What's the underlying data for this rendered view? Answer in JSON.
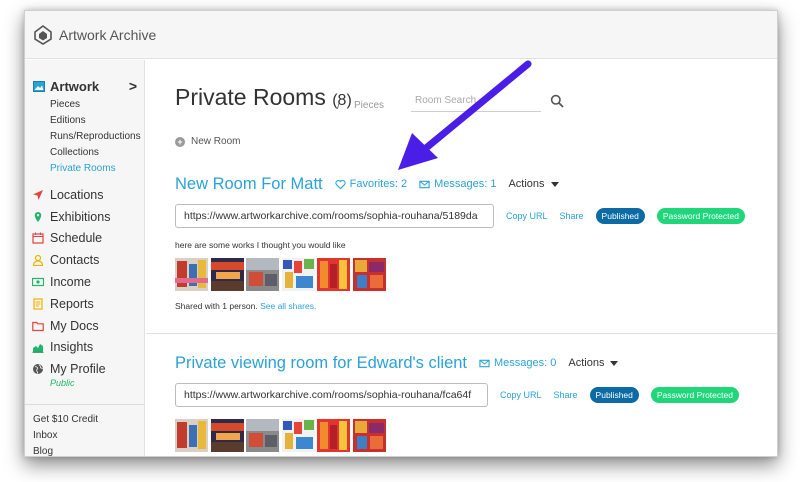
{
  "app": {
    "name": "Artwork Archive"
  },
  "sidebar": {
    "section": {
      "label": "Artwork",
      "expand": ">"
    },
    "subitems": [
      "Pieces",
      "Editions",
      "Runs/Reproductions",
      "Collections",
      "Private Rooms"
    ],
    "active_subitem": "Private Rooms",
    "nav": [
      {
        "label": "Locations",
        "icon": "location-arrow-icon",
        "color": "#e0443a"
      },
      {
        "label": "Exhibitions",
        "icon": "map-pin-icon",
        "color": "#1fb56b"
      },
      {
        "label": "Schedule",
        "icon": "calendar-icon",
        "color": "#e0443a"
      },
      {
        "label": "Contacts",
        "icon": "user-icon",
        "color": "#f0b400"
      },
      {
        "label": "Income",
        "icon": "money-icon",
        "color": "#1fb56b"
      },
      {
        "label": "Reports",
        "icon": "report-icon",
        "color": "#f0b400"
      },
      {
        "label": "My Docs",
        "icon": "folder-icon",
        "color": "#e0443a"
      },
      {
        "label": "Insights",
        "icon": "chart-icon",
        "color": "#1fb56b"
      },
      {
        "label": "My Profile",
        "icon": "globe-icon",
        "color": "#555555"
      }
    ],
    "profile_sub": "Public",
    "bottom_links": [
      "Get $10 Credit",
      "Inbox",
      "Blog"
    ]
  },
  "main": {
    "title": "Private Rooms",
    "count": "(8)",
    "breadcrumb_sep": "/",
    "breadcrumb": "Pieces",
    "search_placeholder": "Room Search",
    "new_room_label": "New Room"
  },
  "rooms": [
    {
      "title": "New Room For Matt",
      "favorites": "Favorites: 2",
      "messages": "Messages: 1",
      "actions": "Actions",
      "url": "https://www.artworkarchive.com/rooms/sophia-rouhana/5189da",
      "copy_url": "Copy URL",
      "share": "Share",
      "published": "Published",
      "password": "Password Protected",
      "message": "here are some works I thought you would like",
      "shared_text": "Shared with 1 person.",
      "shared_link": "See all shares."
    },
    {
      "title": "Private viewing room for Edward's client",
      "messages": "Messages: 0",
      "actions": "Actions",
      "url": "https://www.artworkarchive.com/rooms/sophia-rouhana/fca64f",
      "copy_url": "Copy URL",
      "share": "Share",
      "published": "Published",
      "password": "Password Protected"
    }
  ],
  "colors": {
    "accent": "#2aa2d6",
    "published": "#0c6aa5",
    "password": "#1fd67a",
    "arrow": "#4b1ee8"
  }
}
